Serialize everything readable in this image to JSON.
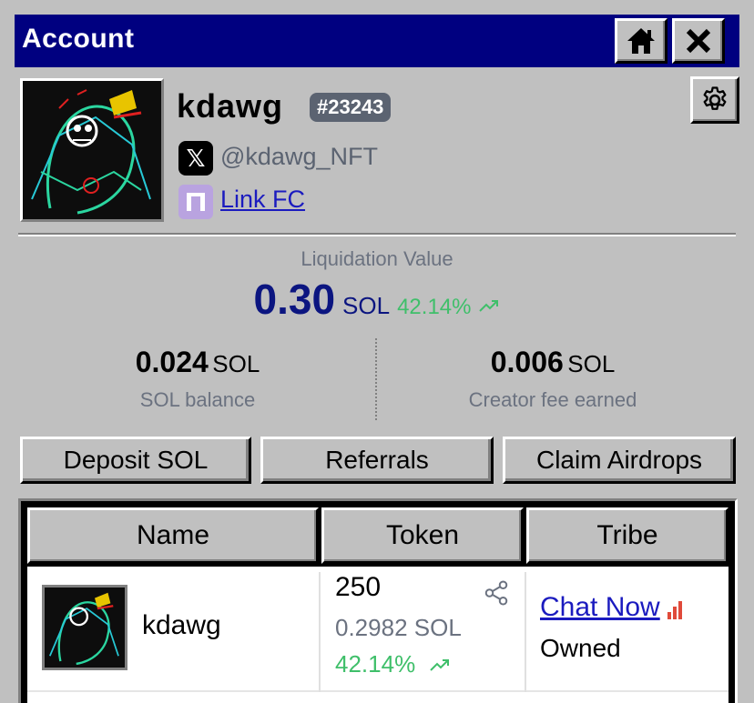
{
  "window": {
    "title": "Account"
  },
  "profile": {
    "username": "kdawg",
    "user_id": "#23243",
    "x_handle": "@kdawg_NFT",
    "fc_link": "Link FC"
  },
  "liquidation": {
    "label": "Liquidation Value",
    "value": "0.30",
    "unit": "SOL",
    "change": "42.14%"
  },
  "stats": {
    "balance": {
      "value": "0.024",
      "unit": "SOL",
      "label": "SOL balance"
    },
    "creator_fee": {
      "value": "0.006",
      "unit": "SOL",
      "label": "Creator fee earned"
    }
  },
  "actions": {
    "deposit": "Deposit SOL",
    "referrals": "Referrals",
    "claim": "Claim Airdrops"
  },
  "table": {
    "headers": {
      "name": "Name",
      "token": "Token",
      "tribe": "Tribe"
    },
    "rows": [
      {
        "name": "kdawg",
        "amount": "250",
        "sol": "0.2982 SOL",
        "change": "42.14%",
        "chat": "Chat Now",
        "status": "Owned"
      }
    ]
  },
  "colors": {
    "titlebar": "#000080",
    "window_bg": "#c0c0c0",
    "positive": "#3fbf6a",
    "link": "#1b1bbf",
    "value": "#0b1580",
    "muted": "#6b7280",
    "badge": "#5b6371"
  },
  "icons": [
    "home-icon",
    "close-icon",
    "gear-icon",
    "x-logo-icon",
    "farcaster-icon",
    "trend-up-icon",
    "share-icon",
    "signal-icon"
  ]
}
